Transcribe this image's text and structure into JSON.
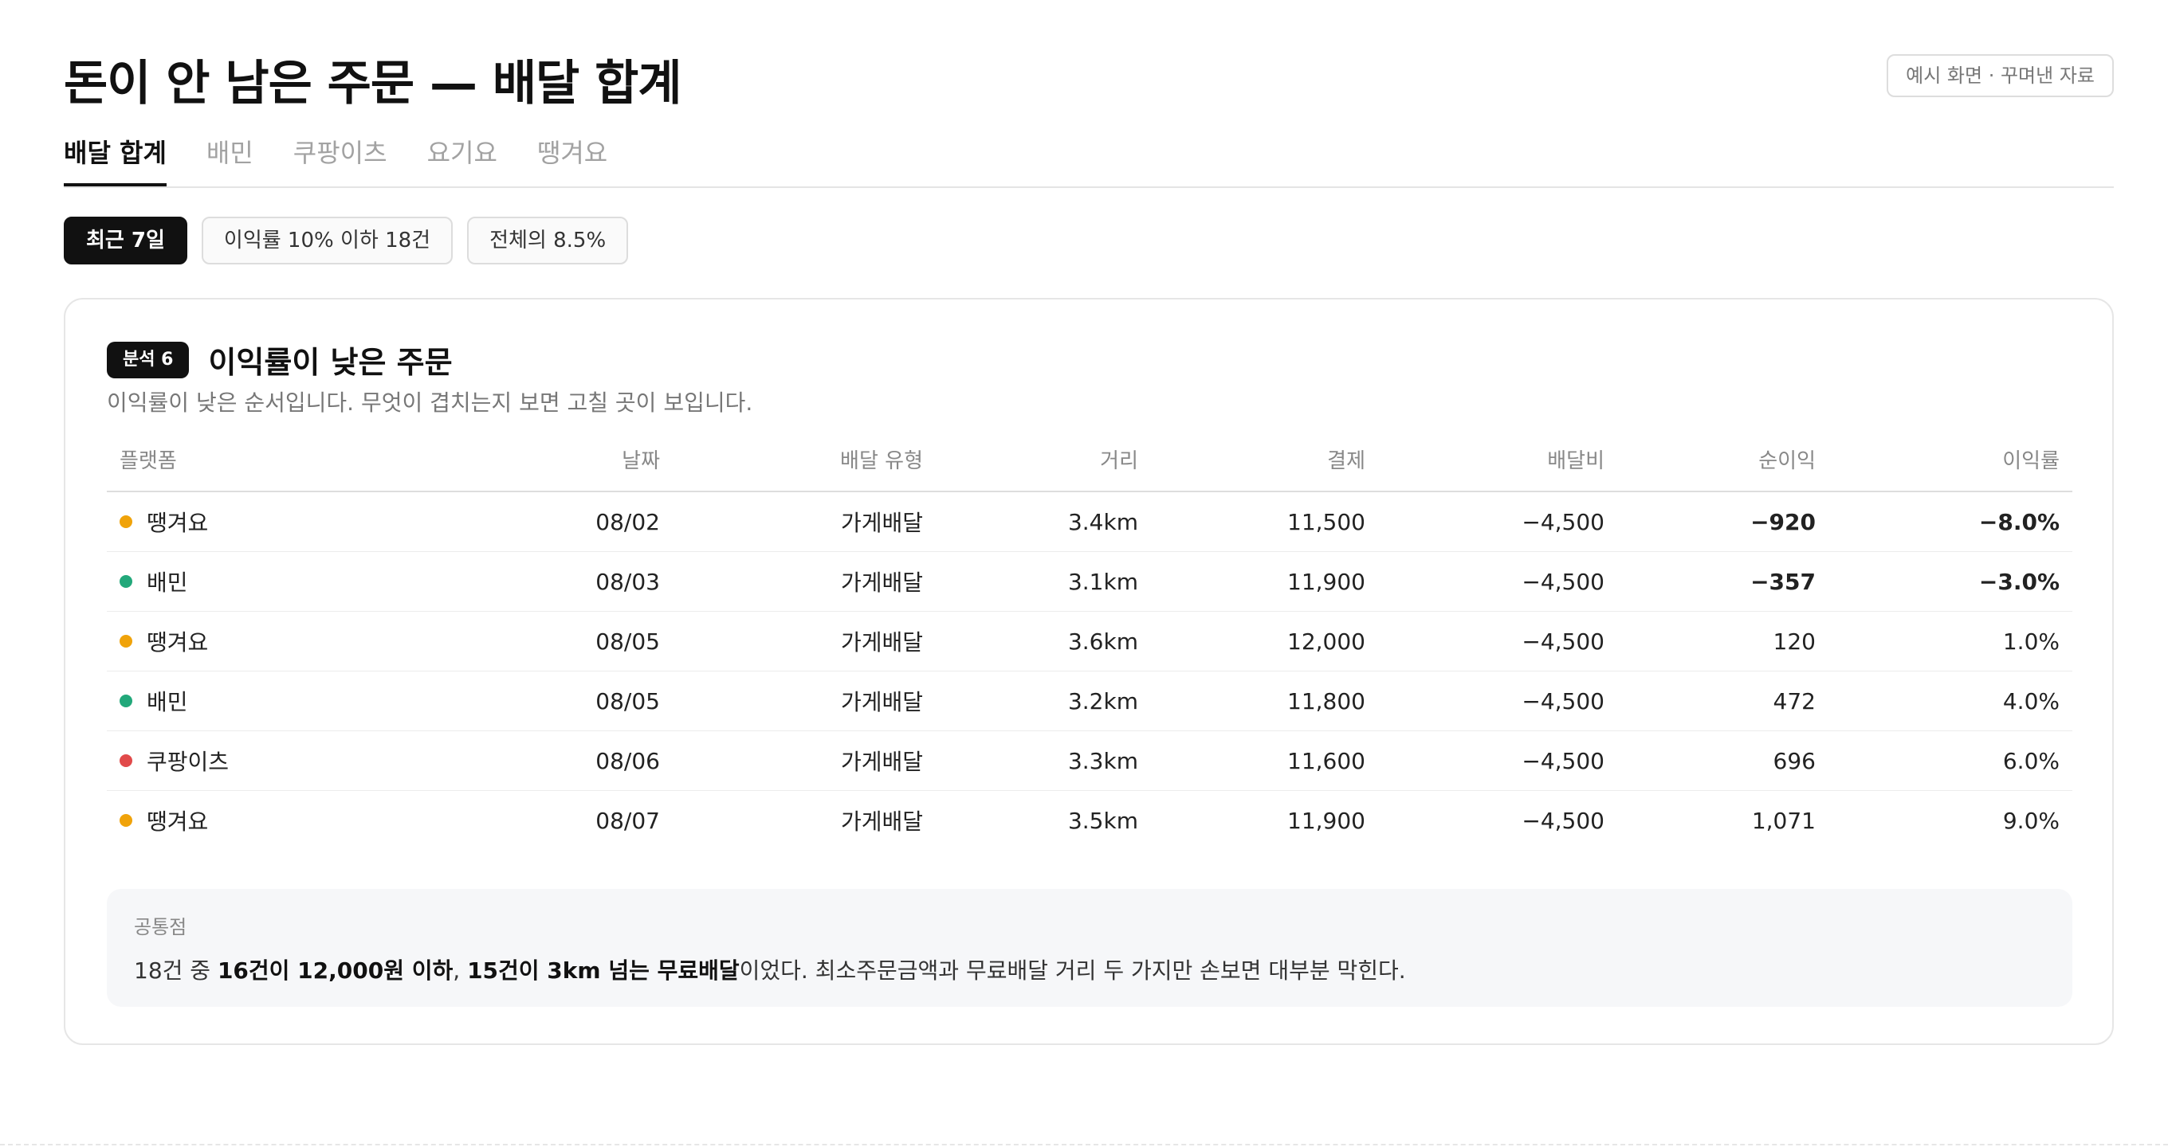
{
  "page": {
    "title": "돈이 안 남은 주문 — 배달 합계",
    "sample_badge": "예시 화면 · 꾸며낸 자료"
  },
  "tabs": [
    {
      "label": "배달 합계",
      "active": true
    },
    {
      "label": "배민",
      "active": false
    },
    {
      "label": "쿠팡이츠",
      "active": false
    },
    {
      "label": "요기요",
      "active": false
    },
    {
      "label": "땡겨요",
      "active": false
    }
  ],
  "filters": [
    {
      "label": "최근 7일",
      "active": true
    },
    {
      "label": "이익률 10% 이하 18건",
      "active": false
    },
    {
      "label": "전체의 8.5%",
      "active": false
    }
  ],
  "card": {
    "badge": "분석 6",
    "title": "이익률이 낮은 주문",
    "description": "이익률이 낮은 순서입니다. 무엇이 겹치는지 보면 고칠 곳이 보입니다."
  },
  "platform_colors": {
    "배민": "#22a87a",
    "쿠팡이츠": "#e14a4a",
    "땡겨요": "#f0a30a"
  },
  "table": {
    "headers": {
      "platform": "플랫폼",
      "date": "날짜",
      "delivery_type": "배달 유형",
      "distance": "거리",
      "payment": "결제",
      "delivery_fee": "배달비",
      "net_profit": "순이익",
      "margin": "이익률"
    },
    "rows": [
      {
        "platform": "땡겨요",
        "date": "08/02",
        "delivery_type": "가게배달",
        "distance": "3.4km",
        "payment": "11,500",
        "delivery_fee": "−4,500",
        "net_profit": "−920",
        "margin": "−8.0%",
        "negative": true
      },
      {
        "platform": "배민",
        "date": "08/03",
        "delivery_type": "가게배달",
        "distance": "3.1km",
        "payment": "11,900",
        "delivery_fee": "−4,500",
        "net_profit": "−357",
        "margin": "−3.0%",
        "negative": true
      },
      {
        "platform": "땡겨요",
        "date": "08/05",
        "delivery_type": "가게배달",
        "distance": "3.6km",
        "payment": "12,000",
        "delivery_fee": "−4,500",
        "net_profit": "120",
        "margin": "1.0%",
        "negative": false
      },
      {
        "platform": "배민",
        "date": "08/05",
        "delivery_type": "가게배달",
        "distance": "3.2km",
        "payment": "11,800",
        "delivery_fee": "−4,500",
        "net_profit": "472",
        "margin": "4.0%",
        "negative": false
      },
      {
        "platform": "쿠팡이츠",
        "date": "08/06",
        "delivery_type": "가게배달",
        "distance": "3.3km",
        "payment": "11,600",
        "delivery_fee": "−4,500",
        "net_profit": "696",
        "margin": "6.0%",
        "negative": false
      },
      {
        "platform": "땡겨요",
        "date": "08/07",
        "delivery_type": "가게배달",
        "distance": "3.5km",
        "payment": "11,900",
        "delivery_fee": "−4,500",
        "net_profit": "1,071",
        "margin": "9.0%",
        "negative": false
      }
    ]
  },
  "common": {
    "label": "공통점",
    "part1": "18건 중 ",
    "bold1": "16건이 12,000원 이하",
    "part2": ", ",
    "bold2": "15건이 3km 넘는 무료배달",
    "part3": "이었다. 최소주문금액과 무료배달 거리 두 가지만 손보면 대부분 막힌다."
  }
}
